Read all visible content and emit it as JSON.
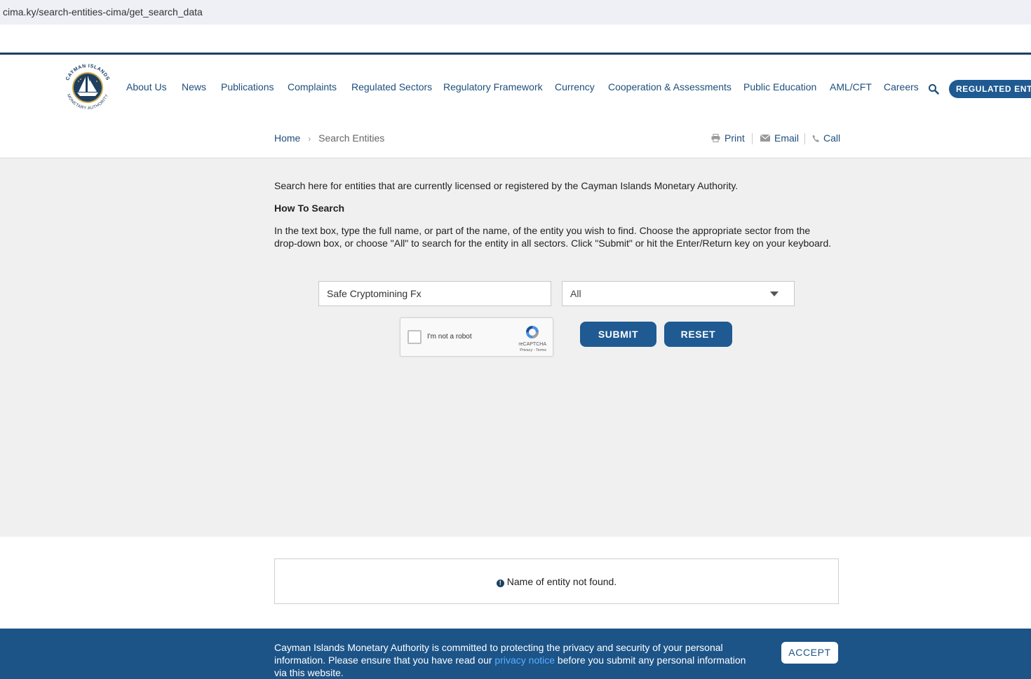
{
  "browser": {
    "url": "cima.ky/search-entities-cima/get_search_data"
  },
  "logo": {
    "top_text": "CAYMAN ISLANDS",
    "bottom_text": "MONETARY AUTHORITY"
  },
  "nav": {
    "items": [
      {
        "label": "About Us"
      },
      {
        "label": "News"
      },
      {
        "label": "Publications"
      },
      {
        "label": "Complaints"
      },
      {
        "label": "Regulated Sectors"
      },
      {
        "label": "Regulatory Framework"
      },
      {
        "label": "Currency"
      },
      {
        "label": "Cooperation & Assessments"
      },
      {
        "label": "Public Education"
      },
      {
        "label": "AML/CFT"
      },
      {
        "label": "Careers"
      }
    ],
    "search_icon": "search-icon",
    "regulated_button": "REGULATED ENTIT"
  },
  "breadcrumb": {
    "home": "Home",
    "separator": "›",
    "current": "Search Entities"
  },
  "actions": {
    "print": "Print",
    "email": "Email",
    "call": "Call"
  },
  "content": {
    "intro": "Search here for entities that are currently licensed or registered by the Cayman Islands Monetary Authority.",
    "howto_title": "How To Search",
    "instructions": "In the text box, type the full name, or part of the name, of the entity you wish to find. Choose the appropriate sector from the drop-down box, or choose \"All\" to search for the entity in all sectors. Click \"Submit\" or hit the Enter/Return key on your keyboard."
  },
  "search": {
    "value": "Safe Cryptomining Fx",
    "sector_selected": "All"
  },
  "captcha": {
    "label": "I'm not a robot",
    "brand": "reCAPTCHA",
    "terms": "Privacy - Terms"
  },
  "buttons": {
    "submit": "SUBMIT",
    "reset": "RESET"
  },
  "result": {
    "icon": "!",
    "message": "Name of entity not found."
  },
  "cookie": {
    "text_before": "Cayman Islands Monetary Authority is committed to protecting the privacy and security of your personal information. Please ensure that you have read our ",
    "link": "privacy notice",
    "text_after": " before you submit any personal information via this website.",
    "accept": "ACCEPT"
  },
  "colors": {
    "brand_blue": "#1f5a92",
    "nav_text": "#1e4e7c",
    "cookie_bg": "#1c5488",
    "gray_bg": "#f0f0f0"
  }
}
